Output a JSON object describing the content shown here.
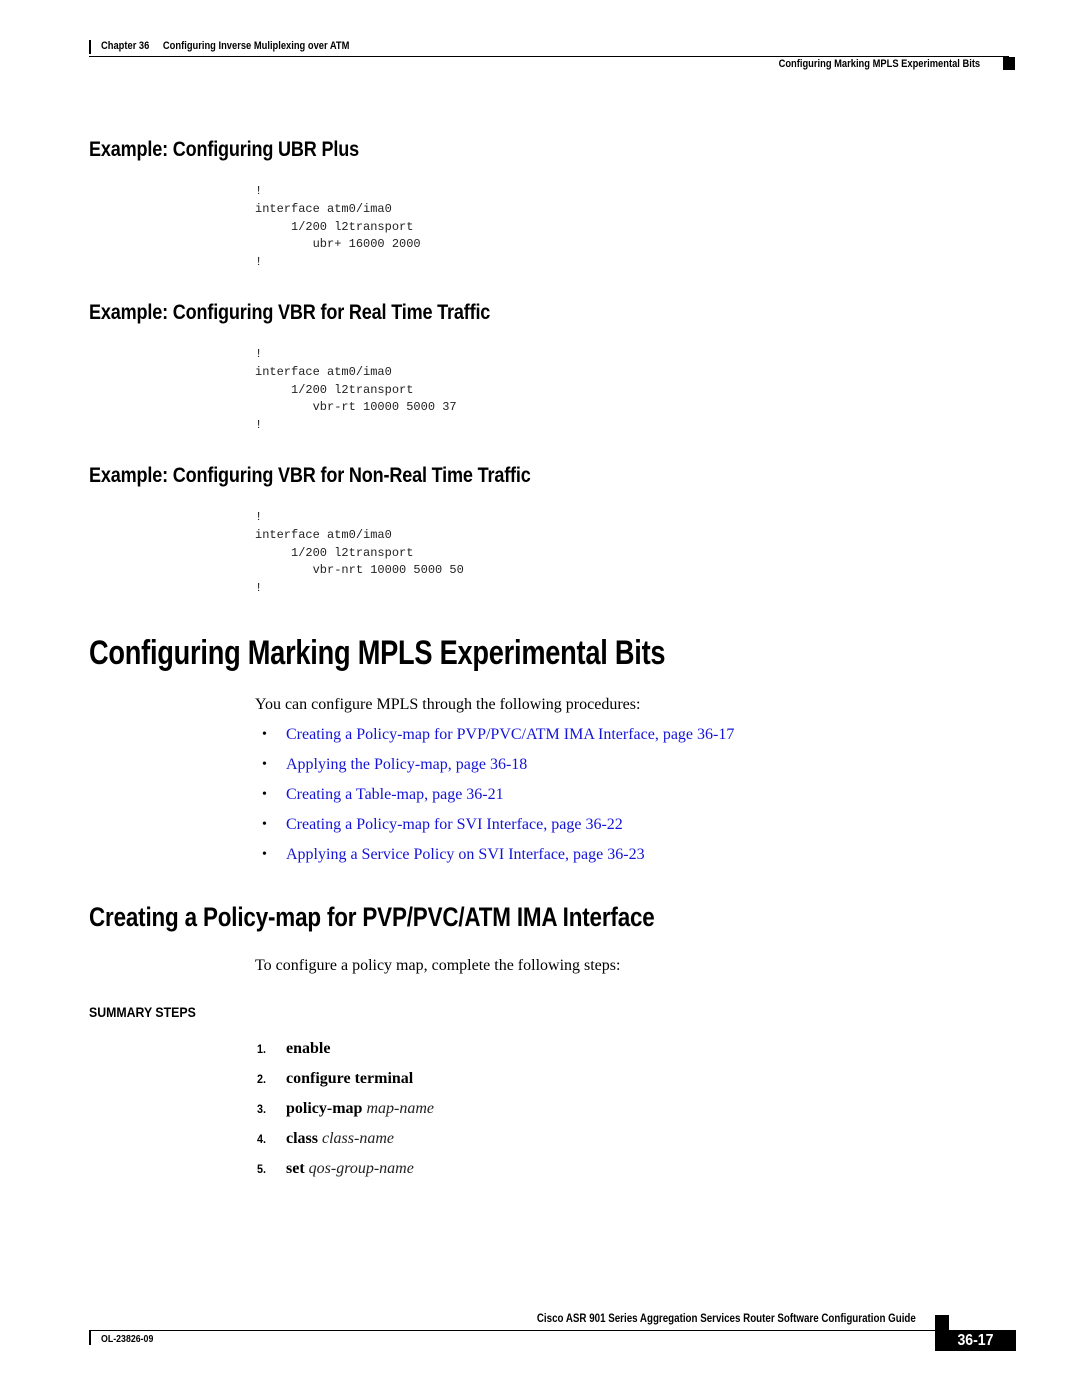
{
  "header": {
    "chapter_label": "Chapter 36",
    "chapter_title": "Configuring Inverse Muliplexing over ATM",
    "section_title": "Configuring Marking MPLS Experimental Bits"
  },
  "sections": {
    "ubr_plus": {
      "heading": "Example: Configuring UBR Plus",
      "code": "!\ninterface atm0/ima0\n     1/200 l2transport\n        ubr+ 16000 2000\n!"
    },
    "vbr_rt": {
      "heading": "Example: Configuring VBR for Real Time Traffic",
      "code": "!\ninterface atm0/ima0\n     1/200 l2transport\n        vbr-rt 10000 5000 37\n!"
    },
    "vbr_nrt": {
      "heading": "Example: Configuring VBR for Non-Real Time Traffic",
      "code": "!\ninterface atm0/ima0\n     1/200 l2transport\n        vbr-nrt 10000 5000 50\n!"
    }
  },
  "mpls": {
    "title": "Configuring Marking MPLS Experimental Bits",
    "intro": "You can configure MPLS through the following procedures:",
    "bullet_glyph": "•",
    "links": [
      {
        "label": "Creating a Policy-map for PVP/PVC/ATM IMA Interface, page 36-17"
      },
      {
        "label": "Applying the Policy-map, page 36-18"
      },
      {
        "label": "Creating a Table-map, page 36-21"
      },
      {
        "label": "Creating a Policy-map for SVI Interface, page 36-22"
      },
      {
        "label": "Applying a Service Policy on SVI Interface, page 36-23"
      }
    ],
    "link_color": "#1414d8"
  },
  "policy_map": {
    "title": "Creating a Policy-map for PVP/PVC/ATM IMA Interface",
    "intro": "To configure a policy map, complete the following steps:",
    "summary_title": "SUMMARY STEPS",
    "steps": [
      {
        "num": "1.",
        "command": "enable",
        "argument": ""
      },
      {
        "num": "2.",
        "command": "configure terminal",
        "argument": ""
      },
      {
        "num": "3.",
        "command": "policy-map",
        "argument": "map-name"
      },
      {
        "num": "4.",
        "command": "class",
        "argument": "class-name"
      },
      {
        "num": "5.",
        "command": "set",
        "argument": "qos-group-name"
      }
    ]
  },
  "footer": {
    "guide_title": "Cisco ASR 901 Series Aggregation Services Router Software Configuration Guide",
    "doc_number": "OL-23826-09",
    "page_number": "36-17"
  }
}
